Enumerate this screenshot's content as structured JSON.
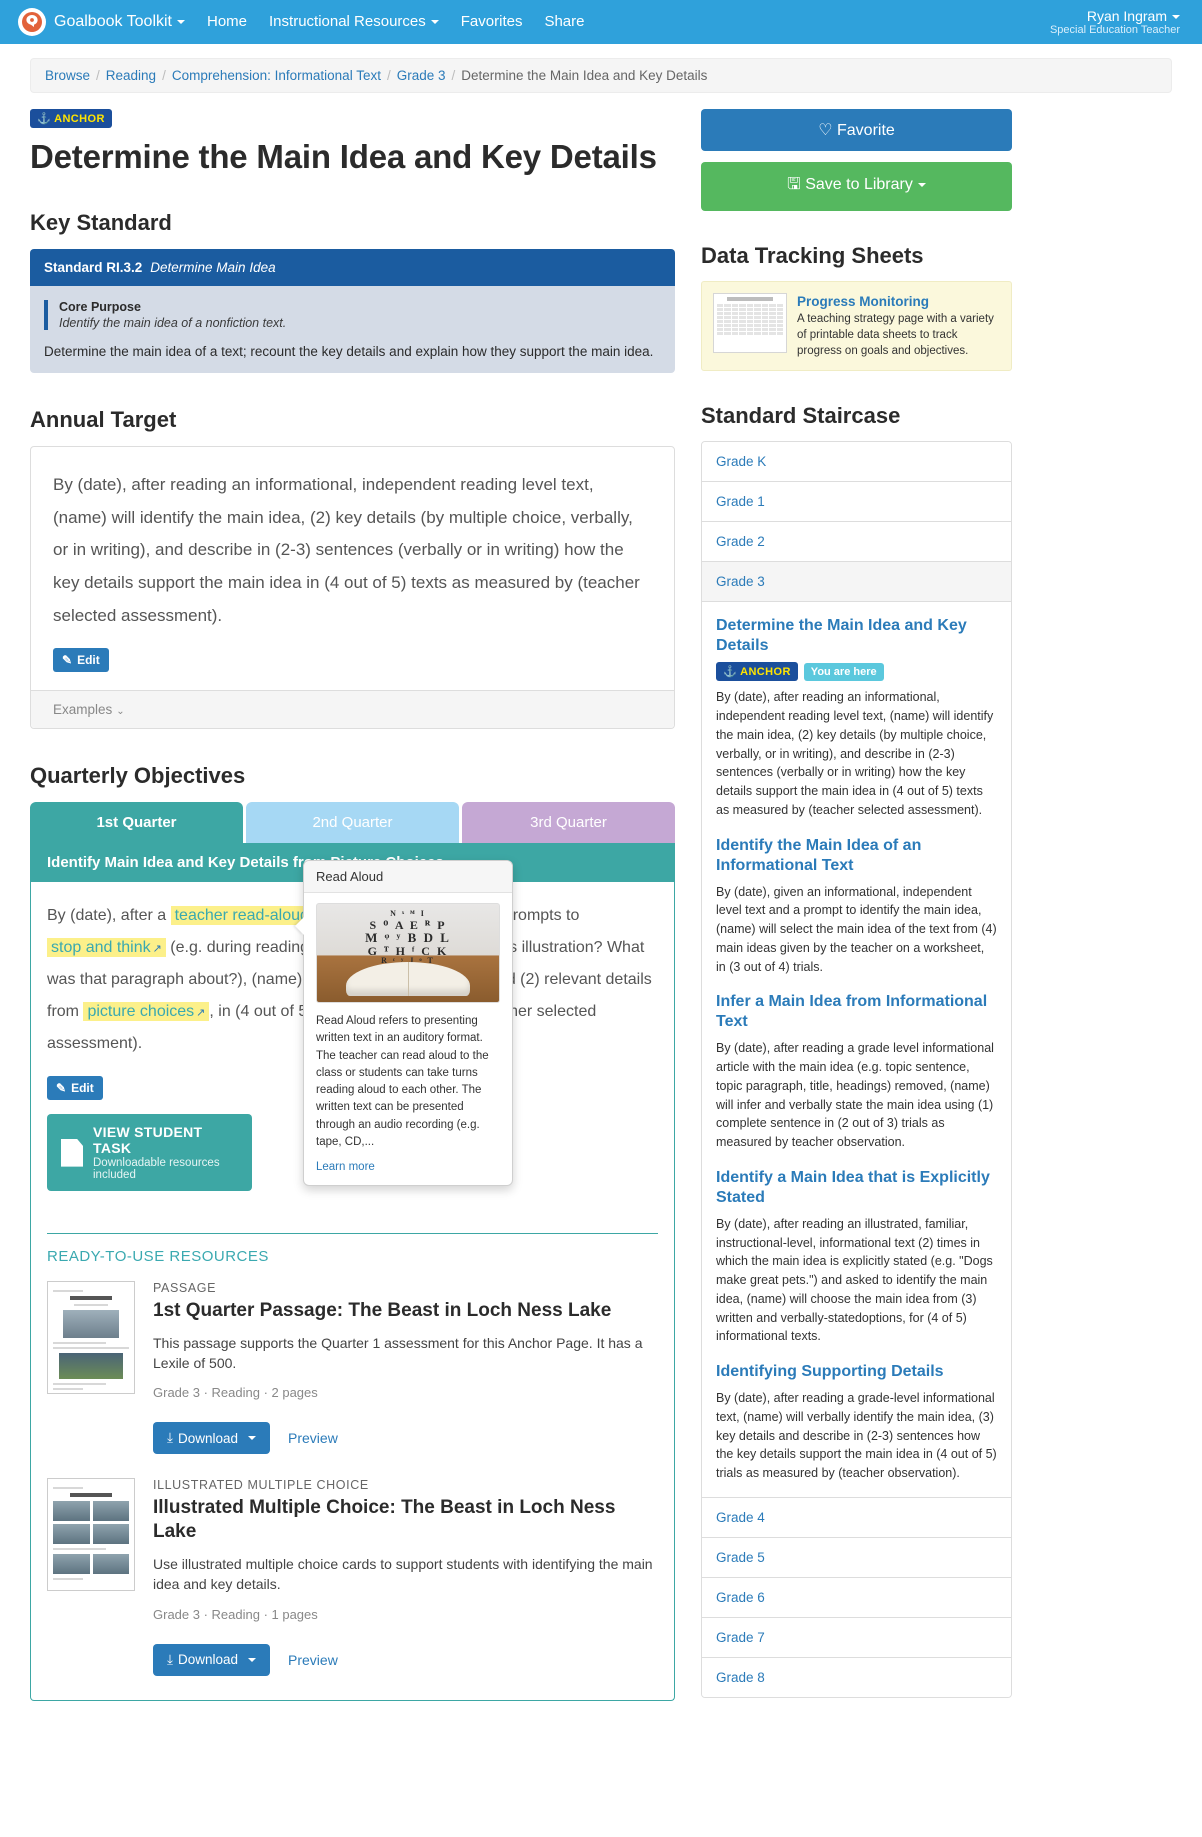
{
  "navbar": {
    "brand": "Goalbook Toolkit",
    "items": [
      {
        "label": "Home",
        "caret": false
      },
      {
        "label": "Instructional Resources",
        "caret": true
      },
      {
        "label": "Favorites",
        "caret": false
      },
      {
        "label": "Share",
        "caret": false
      }
    ],
    "user_name": "Ryan Ingram",
    "user_role": "Special Education Teacher",
    "logo_icon": "goalbook-logo-icon"
  },
  "breadcrumb": {
    "items": [
      "Browse",
      "Reading",
      "Comprehension: Informational Text",
      "Grade 3"
    ],
    "current": "Determine the Main Idea and Key Details"
  },
  "header": {
    "anchor_badge": "ANCHOR",
    "title": "Determine the Main Idea and Key Details"
  },
  "key_standard": {
    "heading": "Key Standard",
    "standard_code": "Standard RI.3.2",
    "standard_name": "Determine Main Idea",
    "core_purpose_label": "Core Purpose",
    "core_purpose_text": "Identify the main idea of a nonfiction text.",
    "description": "Determine the main idea of a text; recount the key details and explain how they support the main idea."
  },
  "annual_target": {
    "heading": "Annual Target",
    "text": "By (date), after reading an informational, independent reading level text, (name) will identify the main idea, (2) key details (by multiple choice, verbally, or in writing), and describe in (2-3) sentences (verbally or in writing) how the key details support the main idea in (4 out of 5) texts as measured by (teacher selected assessment).",
    "edit_label": "Edit",
    "examples_label": "Examples"
  },
  "quarterly": {
    "heading": "Quarterly Objectives",
    "tabs": [
      {
        "label": "1st Quarter",
        "active": true
      },
      {
        "label": "2nd Quarter",
        "active": false
      },
      {
        "label": "3rd Quarter",
        "active": false
      }
    ],
    "objective_title": "Identify Main Idea and Key Details from Picture Choices",
    "text_part1": "By (date), after a ",
    "hl1": "teacher read-aloud",
    "text_part2": " of a grade level text and prompts to ",
    "hl2": "stop and think",
    "text_part3": " (e.g. during reading: What did you learn from this illustration? What was that paragraph about?), (name) will identify the main idea and (2) relevant details from ",
    "hl3": "picture choices",
    "text_part4": ", in (4 out of 5) trials as measured by (teacher selected assessment).",
    "edit_label": "Edit",
    "student_task_title": "VIEW STUDENT TASK",
    "student_task_sub": "Downloadable resources included"
  },
  "popover": {
    "title": "Read Aloud",
    "image_alt": "open-book-with-letters-image",
    "text": "Read Aloud refers to presenting written text in an auditory format. The teacher can read aloud to the class or students can take turns reading aloud to each other. The written text can be presented through an audio recording (e.g. tape, CD,...",
    "link": "Learn more"
  },
  "resources": {
    "heading": "READY-TO-USE RESOURCES",
    "items": [
      {
        "kicker": "PASSAGE",
        "title": "1st Quarter Passage: The Beast in Loch Ness Lake",
        "description": "This passage supports the Quarter 1 assessment for this Anchor Page. It has a Lexile of 500.",
        "meta": "Grade 3 · Reading · 2 pages",
        "download_label": "Download",
        "preview_label": "Preview"
      },
      {
        "kicker": "ILLUSTRATED MULTIPLE CHOICE",
        "title": "Illustrated Multiple Choice: The Beast in Loch Ness Lake",
        "description": "Use illustrated multiple choice cards to support students with identifying the main idea and key details.",
        "meta": "Grade 3 · Reading · 1 pages",
        "download_label": "Download",
        "preview_label": "Preview"
      }
    ]
  },
  "sidebar": {
    "favorite_label": "Favorite",
    "save_label": "Save to Library",
    "data_tracking_heading": "Data Tracking Sheets",
    "progress_card": {
      "title": "Progress Monitoring",
      "description": "A teaching strategy page with a variety of printable data sheets to track progress on goals and objectives."
    },
    "staircase_heading": "Standard Staircase",
    "grades_before": [
      "Grade K",
      "Grade 1",
      "Grade 2"
    ],
    "current_grade": "Grade 3",
    "grades_after": [
      "Grade 4",
      "Grade 5",
      "Grade 6",
      "Grade 7",
      "Grade 8"
    ],
    "anchor_badge": "ANCHOR",
    "here_badge": "You are here",
    "staircase_items": [
      {
        "title": "Determine the Main Idea and Key Details",
        "is_current": true,
        "text": "By (date), after reading an informational, independent reading level text, (name) will identify the main idea, (2) key details (by multiple choice, verbally, or in writing), and describe in (2-3) sentences (verbally or in writing) how the key details support the main idea in (4 out of 5) texts as measured by (teacher selected assessment)."
      },
      {
        "title": "Identify the Main Idea of an Informational Text",
        "is_current": false,
        "text": "By (date), given an informational, independent level text and a prompt to identify the main idea, (name) will select the main idea of the text from (4) main ideas given by the teacher on a worksheet, in (3 out of 4) trials."
      },
      {
        "title": "Infer a Main Idea from Informational Text",
        "is_current": false,
        "text": "By (date), after reading a grade level informational article with the main idea (e.g. topic sentence, topic paragraph, title, headings) removed, (name) will infer and verbally state the main idea using (1) complete sentence in (2 out of 3) trials as measured by teacher observation."
      },
      {
        "title": "Identify a Main Idea that is Explicitly Stated",
        "is_current": false,
        "text": "By (date), after reading an illustrated, familiar, instructional-level, informational text (2) times in which the main idea is explicitly stated (e.g. \"Dogs make great pets.\") and asked to identify the main idea, (name) will choose the main idea from (3) written and verbally-statedoptions, for (4 of 5) informational texts."
      },
      {
        "title": "Identifying Supporting Details",
        "is_current": false,
        "text": "By (date), after reading a grade-level informational text, (name) will verbally identify the main idea, (3) key details and describe in (2-3) sentences how the key details support the main idea in (4 out of 5) trials as measured by (teacher observation)."
      }
    ]
  },
  "colors": {
    "navbar": "#2fa1db",
    "primary_blue": "#2b7bb9",
    "standard_blue": "#1b5ca0",
    "teal": "#3da7a4",
    "green": "#55b85f",
    "highlight_yellow": "#fcf08a",
    "anchor_navy": "#1b4f9c",
    "anchor_yellow": "#ffe400"
  }
}
